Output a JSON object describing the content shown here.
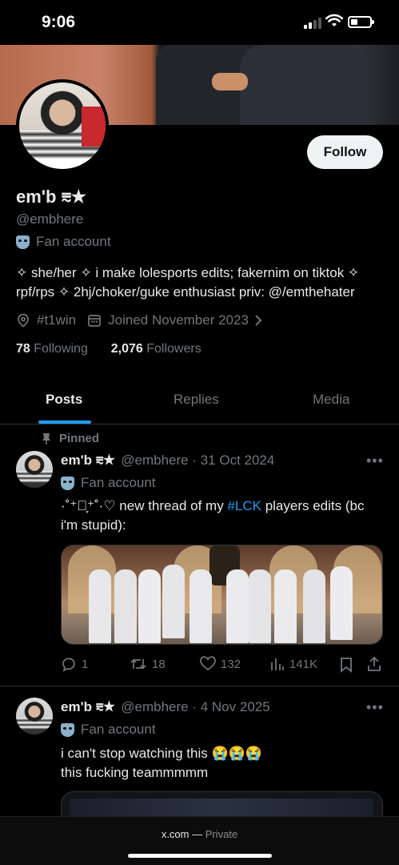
{
  "status_bar": {
    "time": "9:06"
  },
  "profile": {
    "display_name": "em'b ⩳★",
    "handle": "@embhere",
    "account_label": "Fan account",
    "follow_button": "Follow",
    "bio": "✧ she/her ✧ i make lolesports edits; fakernim on tiktok ✧ rpf/rps ✧ 2hj/choker/guke enthusiast priv: @/emthehater",
    "location": "#t1win",
    "joined": "Joined November 2023",
    "following_count": "78",
    "following_label": "Following",
    "followers_count": "2,076",
    "followers_label": "Followers"
  },
  "tabs": [
    "Posts",
    "Replies",
    "Media"
  ],
  "posts": [
    {
      "pinned_label": "Pinned",
      "name": "em'b ⩳★",
      "meta": "@embhere · 31 Oct 2024",
      "account_label": "Fan account",
      "text_pre": "·˚⁺‧͙⁺˚·♡ new thread of my ",
      "hashtag": "#LCK",
      "text_post": " players edits (bc i'm stupid):",
      "replies": "1",
      "reposts": "18",
      "likes": "132",
      "views": "141K"
    },
    {
      "name": "em'b ⩳★",
      "meta": "@embhere · 4 Nov 2025",
      "account_label": "Fan account",
      "text_line1": "i can't stop watching this 😭😭😭",
      "text_line2": "this fucking teammmmm"
    }
  ],
  "browser": {
    "domain": "x.com",
    "mode": "Private"
  },
  "colors": {
    "accent": "#1d9bf0",
    "background": "#000000",
    "muted": "#71767b"
  }
}
